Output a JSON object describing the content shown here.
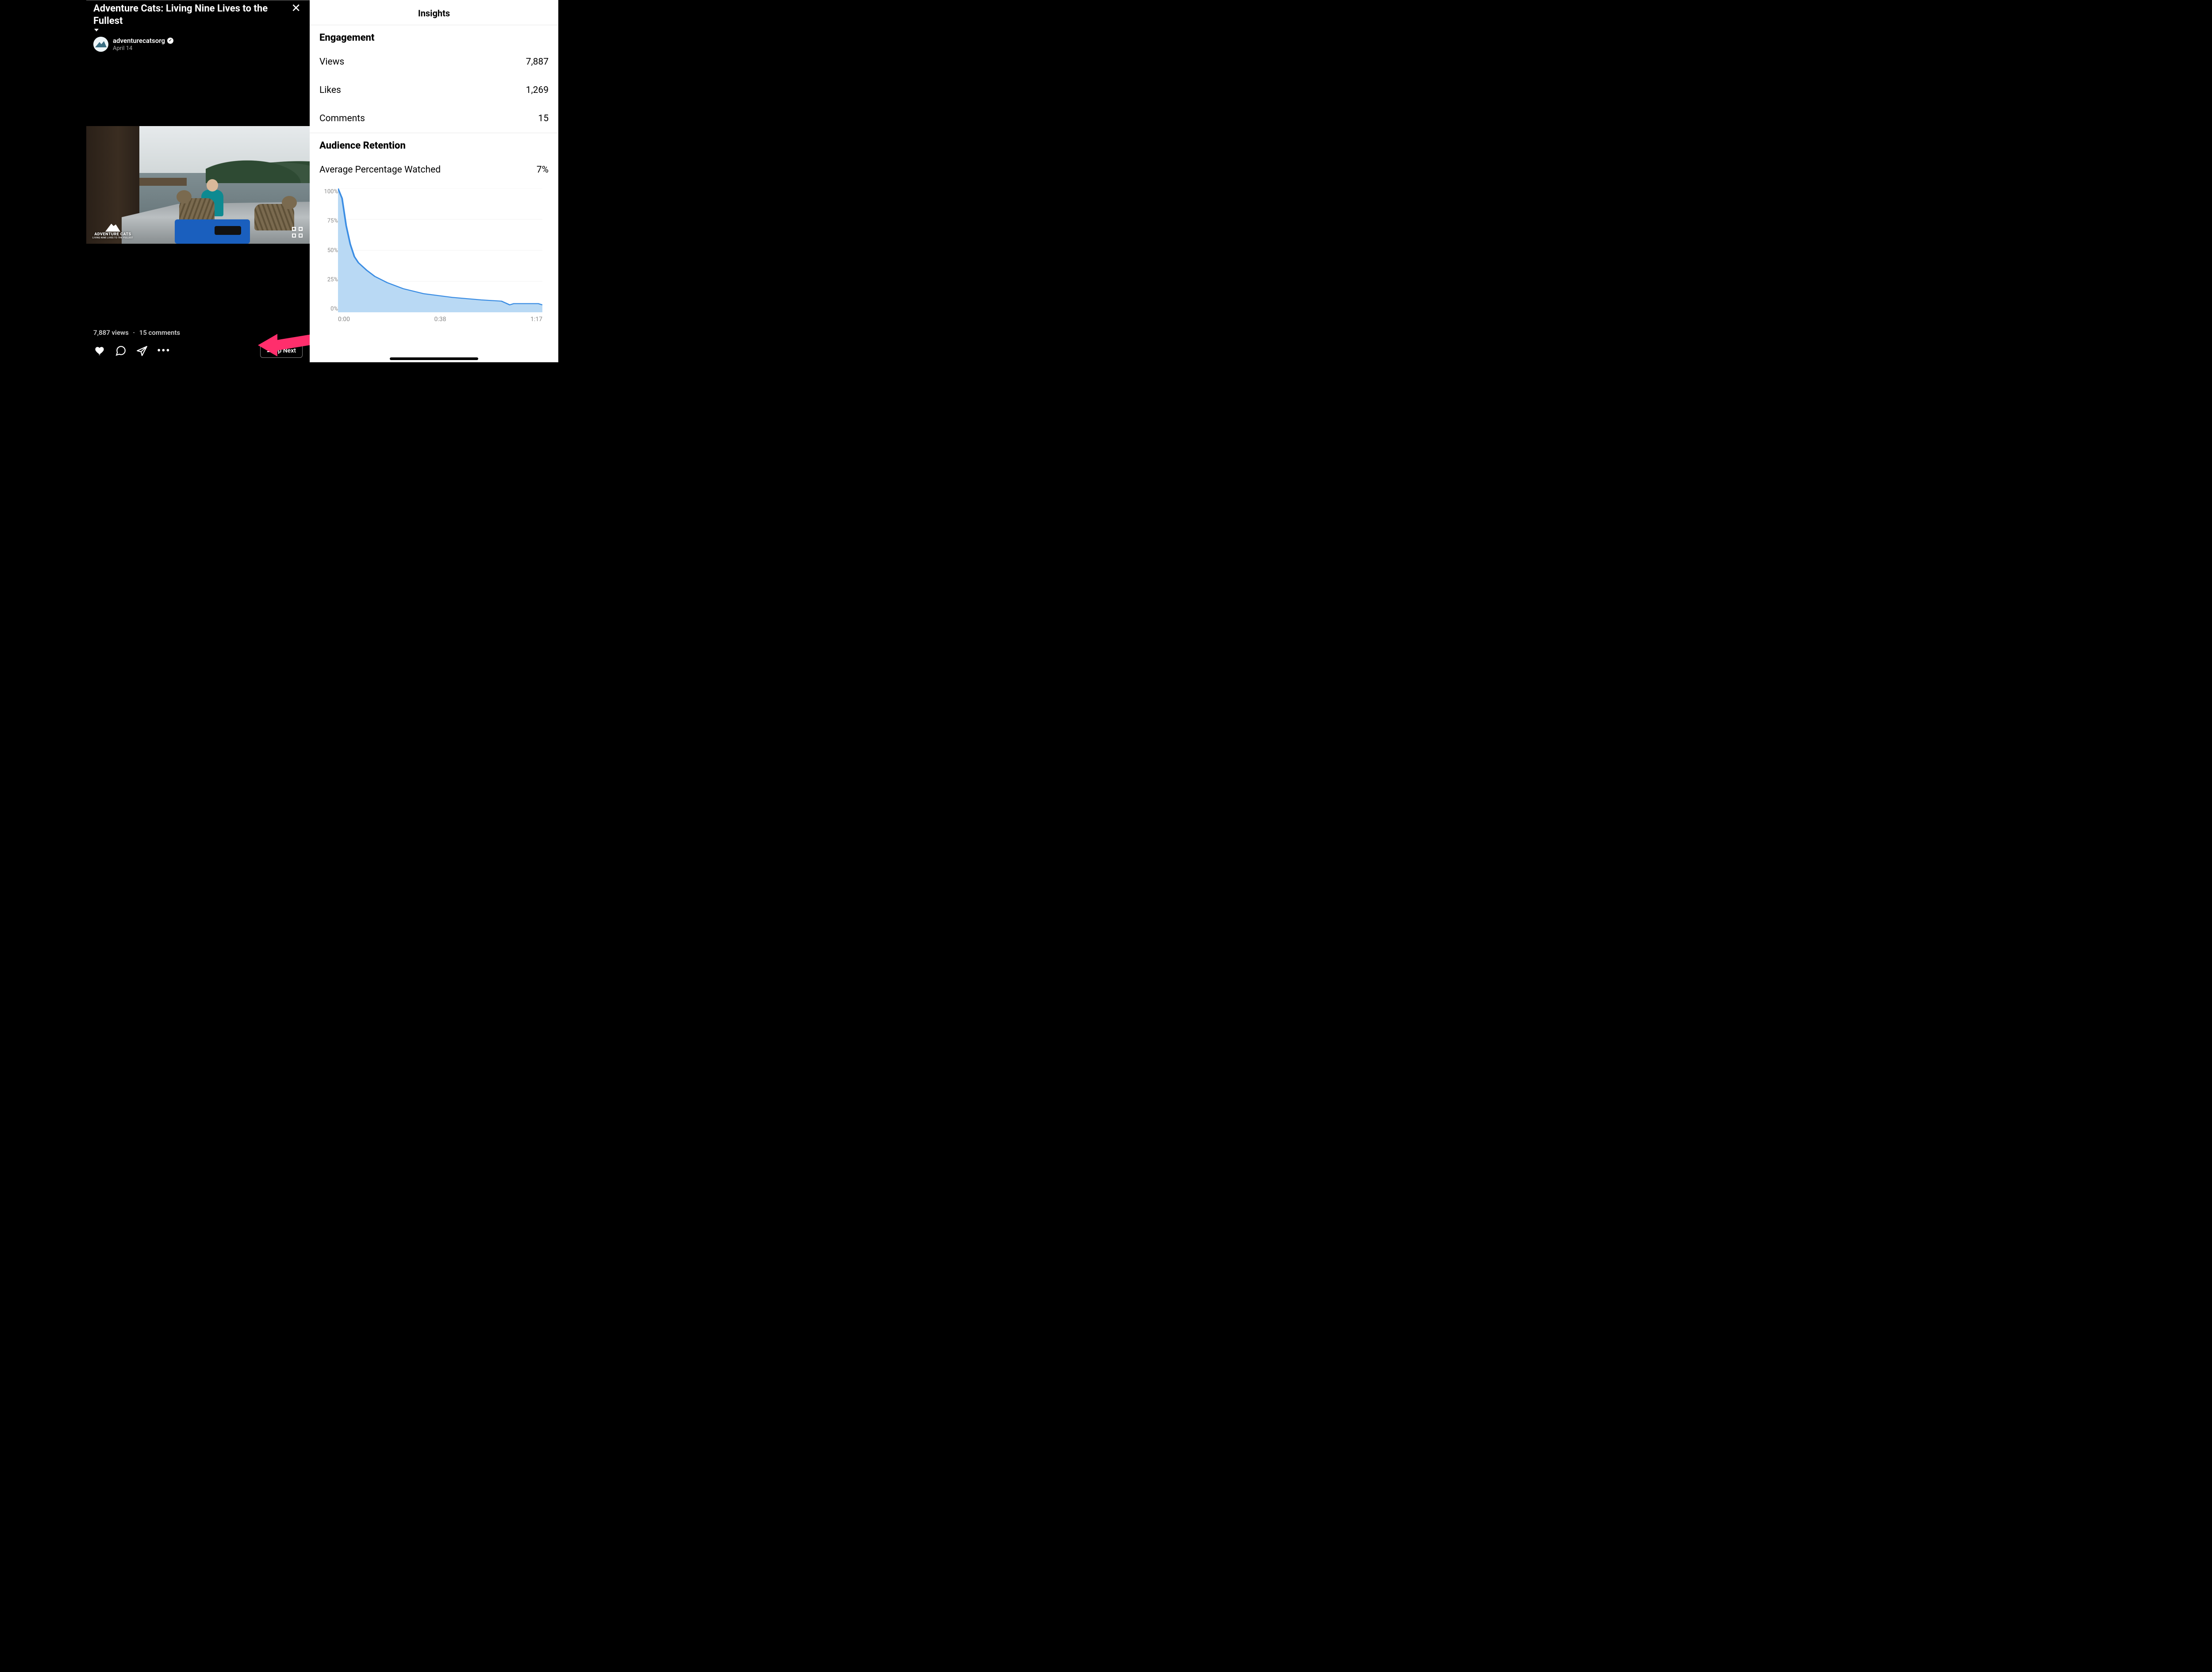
{
  "video": {
    "title": "Adventure Cats: Living Nine Lives to the Fullest",
    "username": "adventurecatsorg",
    "date": "April 14",
    "watermark": "ADVENTURE CATS",
    "watermark_sub": "LIVING NINE LIVES TO THE FULLEST",
    "views_label": "7,887 views",
    "comments_label": "15 comments",
    "up_next": "Up Next"
  },
  "insights": {
    "header": "Insights",
    "engagement_title": "Engagement",
    "views_label": "Views",
    "views_value": "7,887",
    "likes_label": "Likes",
    "likes_value": "1,269",
    "comments_label": "Comments",
    "comments_value": "15",
    "retention_title": "Audience Retention",
    "avg_watched_label": "Average Percentage Watched",
    "avg_watched_value": "7%"
  },
  "chart_data": {
    "type": "area",
    "title": "Audience Retention",
    "xlabel": "",
    "ylabel": "",
    "y_ticks": [
      "100%",
      "75%",
      "50%",
      "25%",
      "0%"
    ],
    "x_ticks": [
      "0:00",
      "0:38",
      "1:17"
    ],
    "ylim": [
      0,
      100
    ],
    "x": [
      0,
      2,
      4,
      6,
      8,
      10,
      14,
      18,
      24,
      32,
      42,
      56,
      70,
      80,
      84,
      86,
      98,
      100
    ],
    "values": [
      100,
      92,
      70,
      55,
      45,
      40,
      34,
      29,
      24,
      19,
      15,
      12,
      10,
      9,
      6,
      7,
      7,
      6
    ],
    "fill_color": "#b9d9f4",
    "stroke_color": "#3b8de3"
  }
}
